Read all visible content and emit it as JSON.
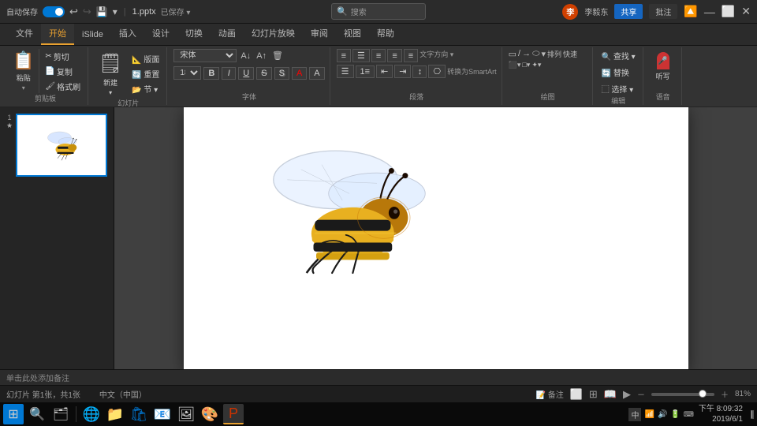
{
  "titlebar": {
    "autosave_label": "自动保存",
    "filename": "1.pptx",
    "save_status": "已保存 ▾",
    "search_placeholder": "搜索",
    "user_initial": "李",
    "share_label": "共享",
    "comment_label": "批注"
  },
  "ribbon_tabs": {
    "tabs": [
      "文件",
      "开始",
      "iSlide",
      "插入",
      "设计",
      "切换",
      "动画",
      "幻灯片放映",
      "审阅",
      "视图",
      "帮助"
    ]
  },
  "ribbon": {
    "clipboard_group": {
      "label": "剪贴板",
      "paste_label": "粘贴",
      "items": [
        "剪切",
        "复制",
        "格式刷"
      ]
    },
    "slides_group": {
      "label": "幻灯片",
      "items": [
        "新建",
        "版面",
        "重置",
        "节"
      ]
    },
    "font_group": {
      "label": "字体",
      "font_name": "宋体",
      "font_size": "18",
      "bold": "B",
      "italic": "I",
      "underline": "U",
      "strikethrough": "S",
      "shadow": "S",
      "color_btn": "A",
      "font_color": "A"
    },
    "paragraph_group": {
      "label": "段落",
      "items": [
        "左对齐",
        "居中",
        "右对齐",
        "两端对齐",
        "分散对齐",
        "项目符号",
        "编号",
        "减少缩进",
        "增加缩进",
        "行距",
        "列",
        "文字方向"
      ]
    },
    "drawing_group": {
      "label": "绘图",
      "items": [
        "形状"
      ]
    },
    "editing_group": {
      "label": "编辑",
      "find_label": "查找",
      "replace_label": "替换",
      "select_label": "选择"
    },
    "voice_group": {
      "label": "语音",
      "dictate_label": "听写"
    }
  },
  "slides": [
    {
      "number": "1",
      "has_star": true
    }
  ],
  "status_bar": {
    "slide_info": "幻灯片 第1张，共1张",
    "language": "中文（中国）",
    "notes_hint": "单击此处添加备注",
    "zoom_level": "81%",
    "view_icons": [
      "正常视图",
      "阅读视图",
      "幻灯片浏览",
      "幻灯片放映"
    ]
  },
  "taskbar": {
    "icons": [
      "⊞",
      "🔍",
      "🗂"
    ],
    "time": "下午 8:09:32",
    "date": "2019/6/1"
  },
  "bee": {
    "description": "Honey bee illustration"
  }
}
